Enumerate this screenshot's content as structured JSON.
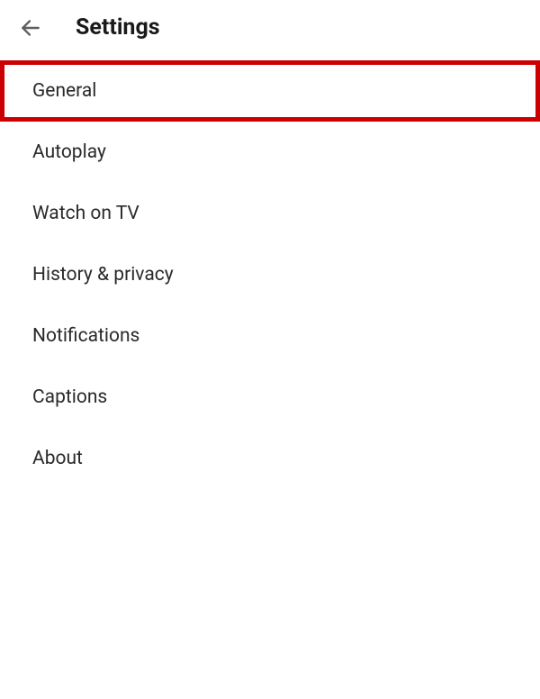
{
  "header": {
    "title": "Settings"
  },
  "list": {
    "items": [
      {
        "label": "General",
        "highlighted": true
      },
      {
        "label": "Autoplay",
        "highlighted": false
      },
      {
        "label": "Watch on TV",
        "highlighted": false
      },
      {
        "label": "History & privacy",
        "highlighted": false
      },
      {
        "label": "Notifications",
        "highlighted": false
      },
      {
        "label": "Captions",
        "highlighted": false
      },
      {
        "label": "About",
        "highlighted": false
      }
    ]
  }
}
